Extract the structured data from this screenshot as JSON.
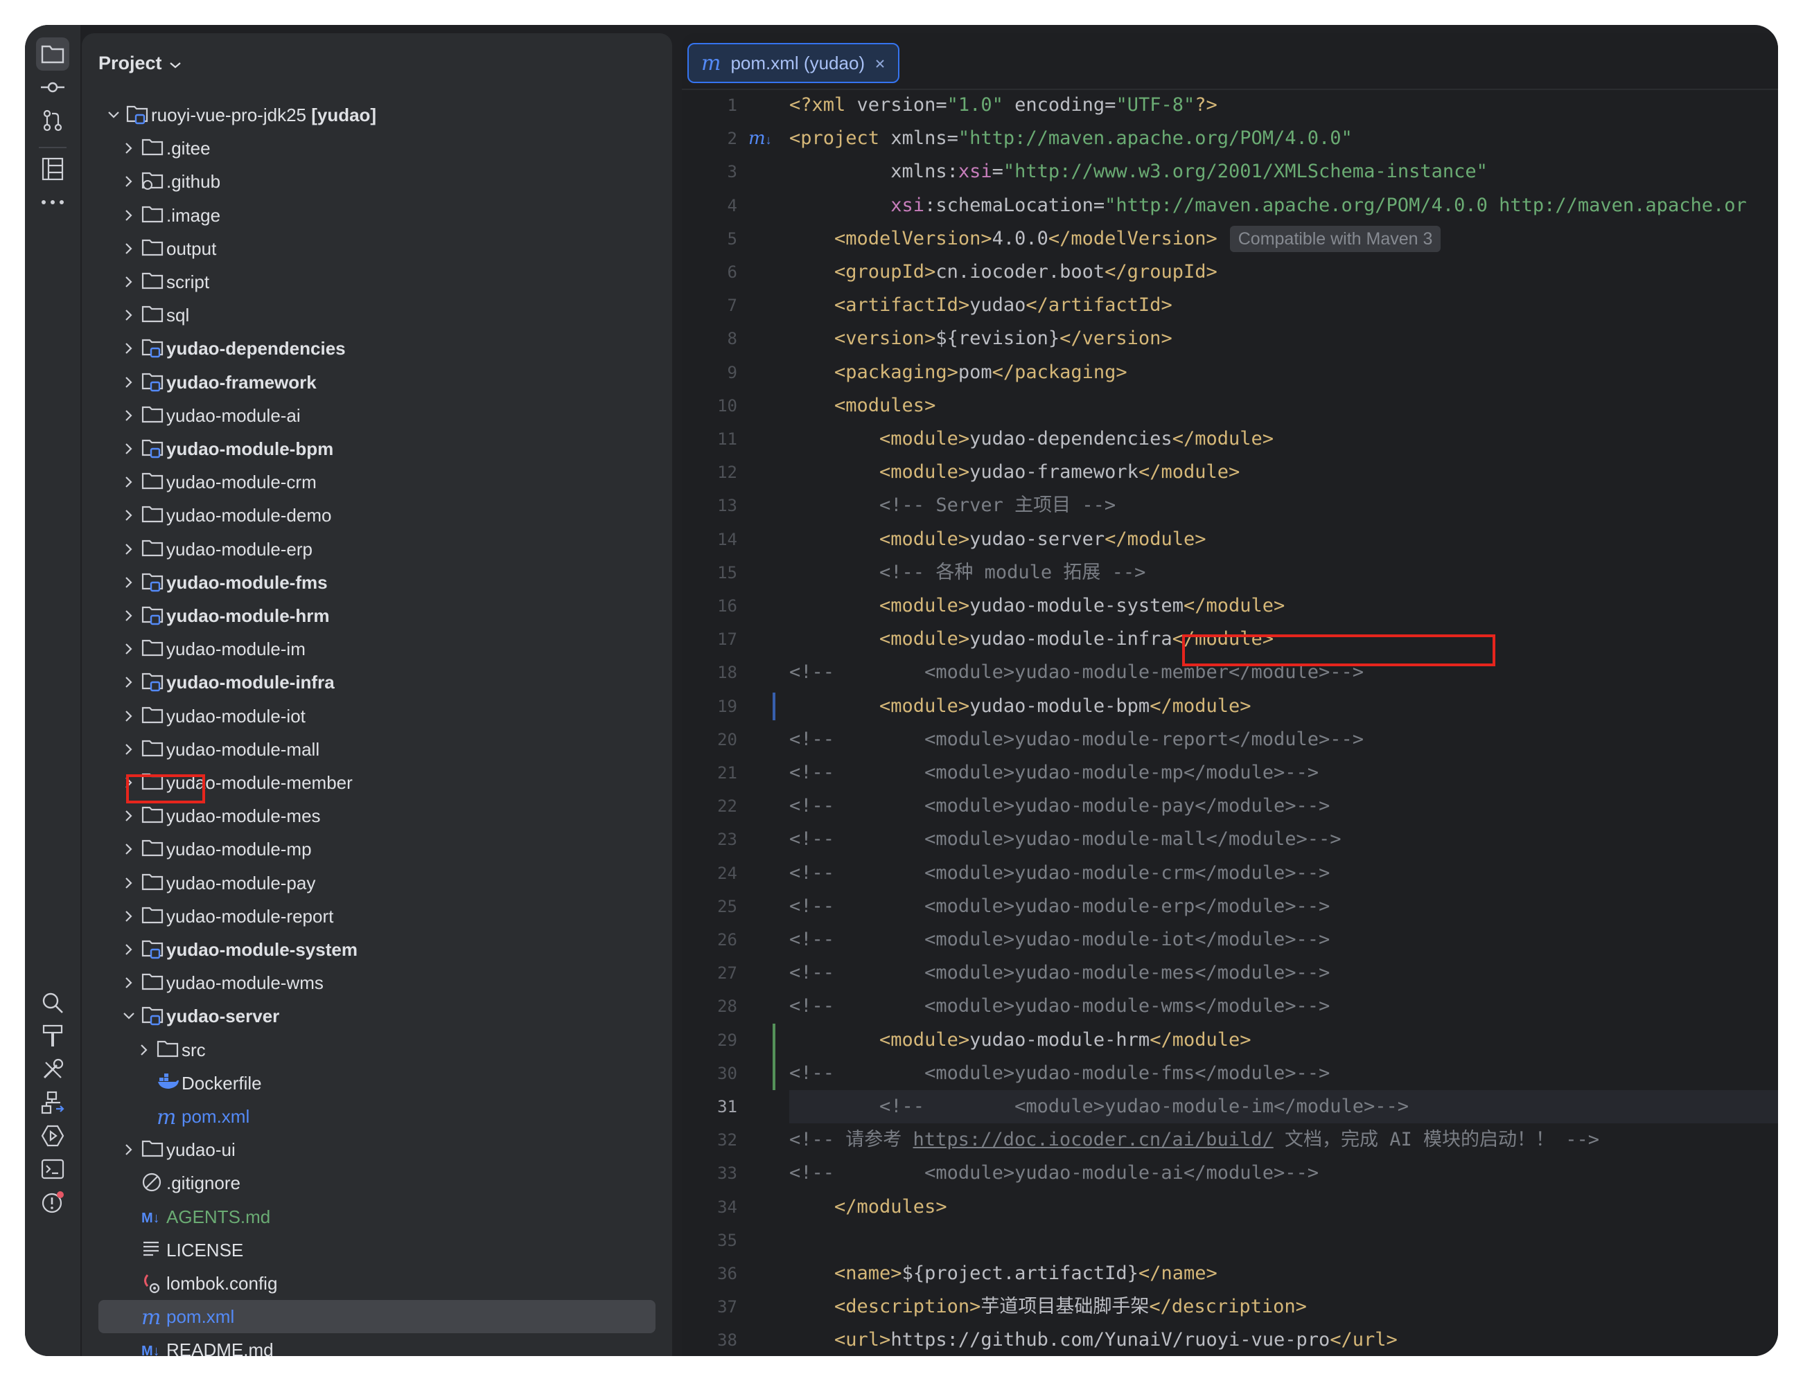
{
  "project_panel": {
    "title": "Project"
  },
  "tree": [
    {
      "label": "ruoyi-vue-pro-jdk25",
      "suffix": " [yudao]",
      "depth": 0,
      "chev": "down",
      "icon": "module-folder-icon"
    },
    {
      "label": ".gitee",
      "depth": 1,
      "chev": "right",
      "icon": "folder-icon"
    },
    {
      "label": ".github",
      "depth": 1,
      "chev": "right",
      "icon": "github-folder-icon"
    },
    {
      "label": ".image",
      "depth": 1,
      "chev": "right",
      "icon": "folder-icon"
    },
    {
      "label": "output",
      "depth": 1,
      "chev": "right",
      "icon": "folder-icon"
    },
    {
      "label": "script",
      "depth": 1,
      "chev": "right",
      "icon": "folder-icon"
    },
    {
      "label": "sql",
      "depth": 1,
      "chev": "right",
      "icon": "folder-icon"
    },
    {
      "label": "yudao-dependencies",
      "depth": 1,
      "chev": "right",
      "icon": "module-folder-icon",
      "bold": true
    },
    {
      "label": "yudao-framework",
      "depth": 1,
      "chev": "right",
      "icon": "module-folder-icon",
      "bold": true
    },
    {
      "label": "yudao-module-ai",
      "depth": 1,
      "chev": "right",
      "icon": "folder-icon"
    },
    {
      "label": "yudao-module-bpm",
      "depth": 1,
      "chev": "right",
      "icon": "module-folder-icon",
      "bold": true
    },
    {
      "label": "yudao-module-crm",
      "depth": 1,
      "chev": "right",
      "icon": "folder-icon"
    },
    {
      "label": "yudao-module-demo",
      "depth": 1,
      "chev": "right",
      "icon": "folder-icon"
    },
    {
      "label": "yudao-module-erp",
      "depth": 1,
      "chev": "right",
      "icon": "folder-icon"
    },
    {
      "label": "yudao-module-fms",
      "depth": 1,
      "chev": "right",
      "icon": "module-folder-icon",
      "bold": true
    },
    {
      "label": "yudao-module-hrm",
      "depth": 1,
      "chev": "right",
      "icon": "module-folder-icon",
      "bold": true
    },
    {
      "label": "yudao-module-im",
      "depth": 1,
      "chev": "right",
      "icon": "folder-icon"
    },
    {
      "label": "yudao-module-infra",
      "depth": 1,
      "chev": "right",
      "icon": "module-folder-icon",
      "bold": true
    },
    {
      "label": "yudao-module-iot",
      "depth": 1,
      "chev": "right",
      "icon": "folder-icon"
    },
    {
      "label": "yudao-module-mall",
      "depth": 1,
      "chev": "right",
      "icon": "folder-icon"
    },
    {
      "label": "yudao-module-member",
      "depth": 1,
      "chev": "right",
      "icon": "folder-icon"
    },
    {
      "label": "yudao-module-mes",
      "depth": 1,
      "chev": "right",
      "icon": "folder-icon"
    },
    {
      "label": "yudao-module-mp",
      "depth": 1,
      "chev": "right",
      "icon": "folder-icon"
    },
    {
      "label": "yudao-module-pay",
      "depth": 1,
      "chev": "right",
      "icon": "folder-icon"
    },
    {
      "label": "yudao-module-report",
      "depth": 1,
      "chev": "right",
      "icon": "folder-icon"
    },
    {
      "label": "yudao-module-system",
      "depth": 1,
      "chev": "right",
      "icon": "module-folder-icon",
      "bold": true
    },
    {
      "label": "yudao-module-wms",
      "depth": 1,
      "chev": "right",
      "icon": "folder-icon"
    },
    {
      "label": "yudao-server",
      "depth": 1,
      "chev": "down",
      "icon": "module-folder-icon",
      "bold": true
    },
    {
      "label": "src",
      "depth": 2,
      "chev": "right",
      "icon": "folder-icon"
    },
    {
      "label": "Dockerfile",
      "depth": 2,
      "chev": "none",
      "icon": "docker-icon"
    },
    {
      "label": "pom.xml",
      "depth": 2,
      "chev": "none",
      "icon": "maven-icon",
      "color": "#548af7"
    },
    {
      "label": "yudao-ui",
      "depth": 1,
      "chev": "right",
      "icon": "folder-icon"
    },
    {
      "label": ".gitignore",
      "depth": 1,
      "chev": "none",
      "icon": "gitignore-icon"
    },
    {
      "label": "AGENTS.md",
      "depth": 1,
      "chev": "none",
      "icon": "markdown-icon",
      "color": "#6aab73"
    },
    {
      "label": "LICENSE",
      "depth": 1,
      "chev": "none",
      "icon": "text-file-icon"
    },
    {
      "label": "lombok.config",
      "depth": 1,
      "chev": "none",
      "icon": "config-icon"
    },
    {
      "label": "pom.xml",
      "depth": 1,
      "chev": "none",
      "icon": "maven-icon",
      "color": "#548af7",
      "selected": true
    },
    {
      "label": "README.md",
      "depth": 1,
      "chev": "none",
      "icon": "markdown-icon"
    }
  ],
  "editor": {
    "tab_label": "pom.xml (yudao)",
    "current_line": 31,
    "maven_hint": "Compatible with Maven 3",
    "lines": [
      {
        "n": 1,
        "seg": [
          [
            "tag",
            "<?xml "
          ],
          [
            "attr",
            "version="
          ],
          [
            "val",
            "\"1.0\""
          ],
          [
            "attr",
            " encoding="
          ],
          [
            "val",
            "\"UTF-8\""
          ],
          [
            "tag",
            "?>"
          ]
        ]
      },
      {
        "n": 2,
        "seg": [
          [
            "tag",
            "<project "
          ],
          [
            "attr",
            "xmlns="
          ],
          [
            "val",
            "\"http://maven.apache.org/POM/4.0.0\""
          ]
        ]
      },
      {
        "n": 3,
        "seg": [
          [
            "attr",
            "         xmlns:"
          ],
          [
            "ns",
            "xsi"
          ],
          [
            "attr",
            "="
          ],
          [
            "val",
            "\"http://www.w3.org/2001/XMLSchema-instance\""
          ]
        ]
      },
      {
        "n": 4,
        "seg": [
          [
            "ns",
            "         xsi"
          ],
          [
            "attr",
            ":schemaLocation="
          ],
          [
            "val",
            "\"http://maven.apache.org/POM/4.0.0 http://maven.apache.or"
          ]
        ]
      },
      {
        "n": 5,
        "seg": [
          [
            "tag",
            "    <modelVersion>"
          ],
          [
            "attr",
            "4.0.0"
          ],
          [
            "tag",
            "</modelVersion>"
          ]
        ],
        "hint": true
      },
      {
        "n": 6,
        "seg": [
          [
            "tag",
            "    <groupId>"
          ],
          [
            "attr",
            "cn.iocoder.boot"
          ],
          [
            "tag",
            "</groupId>"
          ]
        ]
      },
      {
        "n": 7,
        "seg": [
          [
            "tag",
            "    <artifactId>"
          ],
          [
            "attr",
            "yudao"
          ],
          [
            "tag",
            "</artifactId>"
          ]
        ]
      },
      {
        "n": 8,
        "seg": [
          [
            "tag",
            "    <version>"
          ],
          [
            "attr",
            "${revision}"
          ],
          [
            "tag",
            "</version>"
          ]
        ]
      },
      {
        "n": 9,
        "seg": [
          [
            "tag",
            "    <packaging>"
          ],
          [
            "attr",
            "pom"
          ],
          [
            "tag",
            "</packaging>"
          ]
        ]
      },
      {
        "n": 10,
        "seg": [
          [
            "tag",
            "    <modules>"
          ]
        ]
      },
      {
        "n": 11,
        "seg": [
          [
            "tag",
            "        <module>"
          ],
          [
            "attr",
            "yudao-dependencies"
          ],
          [
            "tag",
            "</module>"
          ]
        ]
      },
      {
        "n": 12,
        "seg": [
          [
            "tag",
            "        <module>"
          ],
          [
            "attr",
            "yudao-framework"
          ],
          [
            "tag",
            "</module>"
          ]
        ]
      },
      {
        "n": 13,
        "seg": [
          [
            "cmt",
            "        <!-- Server 主项目 -->"
          ]
        ]
      },
      {
        "n": 14,
        "seg": [
          [
            "tag",
            "        <module>"
          ],
          [
            "attr",
            "yudao-server"
          ],
          [
            "tag",
            "</module>"
          ]
        ]
      },
      {
        "n": 15,
        "seg": [
          [
            "cmt",
            "        <!-- 各种 module 拓展 -->"
          ]
        ]
      },
      {
        "n": 16,
        "seg": [
          [
            "tag",
            "        <module>"
          ],
          [
            "attr",
            "yudao-module-system"
          ],
          [
            "tag",
            "</module>"
          ]
        ]
      },
      {
        "n": 17,
        "seg": [
          [
            "tag",
            "        <module>"
          ],
          [
            "attr",
            "yudao-module-infra"
          ],
          [
            "tag",
            "</module>"
          ]
        ]
      },
      {
        "n": 18,
        "seg": [
          [
            "cmt",
            "<!--        <module>yudao-module-member</module>-->"
          ]
        ]
      },
      {
        "n": 19,
        "seg": [
          [
            "tag",
            "        <module>"
          ],
          [
            "attr",
            "yudao-module-bpm"
          ],
          [
            "tag",
            "</module>"
          ]
        ]
      },
      {
        "n": 20,
        "seg": [
          [
            "cmt",
            "<!--        <module>yudao-module-report</module>-->"
          ]
        ]
      },
      {
        "n": 21,
        "seg": [
          [
            "cmt",
            "<!--        <module>yudao-module-mp</module>-->"
          ]
        ]
      },
      {
        "n": 22,
        "seg": [
          [
            "cmt",
            "<!--        <module>yudao-module-pay</module>-->"
          ]
        ]
      },
      {
        "n": 23,
        "seg": [
          [
            "cmt",
            "<!--        <module>yudao-module-mall</module>-->"
          ]
        ]
      },
      {
        "n": 24,
        "seg": [
          [
            "cmt",
            "<!--        <module>yudao-module-crm</module>-->"
          ]
        ]
      },
      {
        "n": 25,
        "seg": [
          [
            "cmt",
            "<!--        <module>yudao-module-erp</module>-->"
          ]
        ]
      },
      {
        "n": 26,
        "seg": [
          [
            "cmt",
            "<!--        <module>yudao-module-iot</module>-->"
          ]
        ]
      },
      {
        "n": 27,
        "seg": [
          [
            "cmt",
            "<!--        <module>yudao-module-mes</module>-->"
          ]
        ]
      },
      {
        "n": 28,
        "seg": [
          [
            "cmt",
            "<!--        <module>yudao-module-wms</module>-->"
          ]
        ]
      },
      {
        "n": 29,
        "seg": [
          [
            "tag",
            "        <module>"
          ],
          [
            "attr",
            "yudao-module-hrm"
          ],
          [
            "tag",
            "</module>"
          ]
        ]
      },
      {
        "n": 30,
        "seg": [
          [
            "cmt",
            "<!--        <module>yudao-module-fms</module>-->"
          ]
        ]
      },
      {
        "n": 31,
        "seg": [
          [
            "cmt",
            "        <!--        <module>yudao-module-im</module>-->"
          ]
        ]
      },
      {
        "n": 32,
        "seg": [
          [
            "cmt",
            "<!-- 请参考 "
          ],
          [
            "lnk",
            "https://doc.iocoder.cn/ai/build/"
          ],
          [
            "cmt",
            " 文档，完成 AI 模块的启动！！ -->"
          ]
        ]
      },
      {
        "n": 33,
        "seg": [
          [
            "cmt",
            "<!--        <module>yudao-module-ai</module>-->"
          ]
        ]
      },
      {
        "n": 34,
        "seg": [
          [
            "tag",
            "    </modules>"
          ]
        ]
      },
      {
        "n": 35,
        "seg": []
      },
      {
        "n": 36,
        "seg": [
          [
            "tag",
            "    <name>"
          ],
          [
            "attr",
            "${project.artifactId}"
          ],
          [
            "tag",
            "</name>"
          ]
        ]
      },
      {
        "n": 37,
        "seg": [
          [
            "tag",
            "    <description>"
          ],
          [
            "attr",
            "芋道项目基础脚手架"
          ],
          [
            "tag",
            "</description>"
          ]
        ]
      },
      {
        "n": 38,
        "seg": [
          [
            "tag",
            "    <url>"
          ],
          [
            "attr",
            "https://github.com/YunaiV/ruoyi-vue-pro"
          ],
          [
            "tag",
            "</url>"
          ]
        ]
      }
    ]
  }
}
